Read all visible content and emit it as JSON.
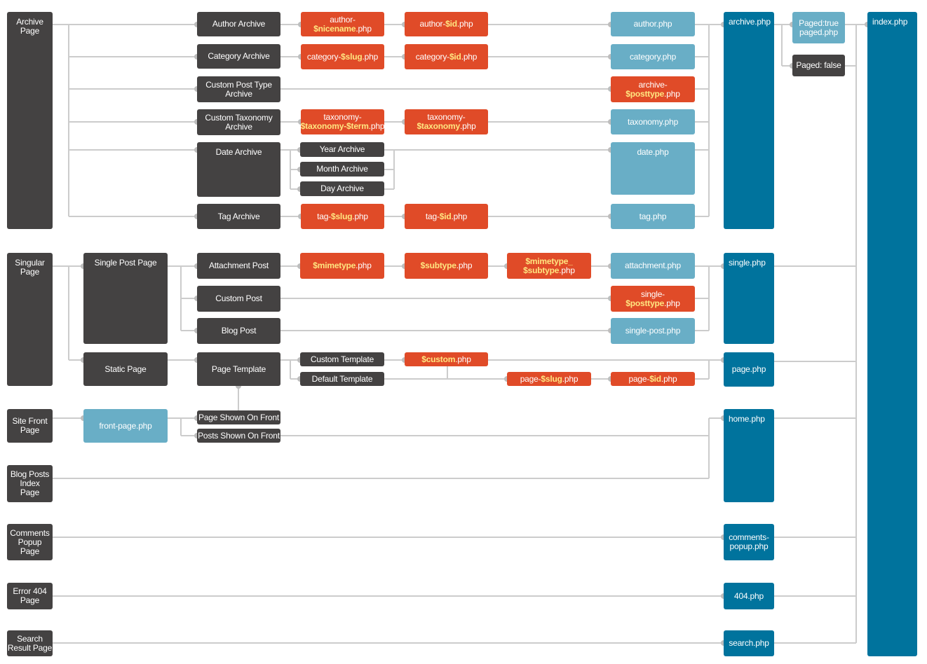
{
  "colors": {
    "dark": "#444242",
    "red": "#e04b28",
    "light": "#69aec6",
    "blue": "#00739d",
    "wire": "#cccccc",
    "variable": "#ffe680"
  },
  "nodes": [
    {
      "id": "archive-page",
      "kind": "dark",
      "lines": [
        [
          {
            "text": "Archive"
          }
        ],
        [
          {
            "text": "Page"
          }
        ]
      ]
    },
    {
      "id": "author-archive",
      "kind": "dark",
      "lines": [
        [
          {
            "text": "Author Archive"
          }
        ]
      ]
    },
    {
      "id": "category-archive",
      "kind": "dark",
      "lines": [
        [
          {
            "text": "Category Archive"
          }
        ]
      ]
    },
    {
      "id": "cpt-archive",
      "kind": "dark",
      "lines": [
        [
          {
            "text": "Custom Post Type"
          }
        ],
        [
          {
            "text": "Archive"
          }
        ]
      ]
    },
    {
      "id": "tax-archive",
      "kind": "dark",
      "lines": [
        [
          {
            "text": "Custom Taxonomy"
          }
        ],
        [
          {
            "text": "Archive"
          }
        ]
      ]
    },
    {
      "id": "date-archive",
      "kind": "dark",
      "lines": [
        [
          {
            "text": "Date Archive"
          }
        ]
      ]
    },
    {
      "id": "tag-archive",
      "kind": "dark",
      "lines": [
        [
          {
            "text": "Tag Archive"
          }
        ]
      ]
    },
    {
      "id": "author-nicename",
      "kind": "red",
      "lines": [
        [
          {
            "text": "author-"
          }
        ],
        [
          {
            "text": "$nicename",
            "var": true
          },
          {
            "text": ".php"
          }
        ]
      ]
    },
    {
      "id": "category-slug",
      "kind": "red",
      "lines": [
        [
          {
            "text": "category-"
          },
          {
            "text": "$slug",
            "var": true
          },
          {
            "text": ".php"
          }
        ]
      ]
    },
    {
      "id": "taxonomy-term",
      "kind": "red",
      "lines": [
        [
          {
            "text": "taxonomy-"
          }
        ],
        [
          {
            "text": "$taxonomy-$term",
            "var": true
          },
          {
            "text": ".php"
          }
        ]
      ]
    },
    {
      "id": "year-archive",
      "kind": "dark",
      "lines": [
        [
          {
            "text": "Year Archive"
          }
        ]
      ]
    },
    {
      "id": "month-archive",
      "kind": "dark",
      "lines": [
        [
          {
            "text": "Month Archive"
          }
        ]
      ]
    },
    {
      "id": "day-archive",
      "kind": "dark",
      "lines": [
        [
          {
            "text": "Day Archive"
          }
        ]
      ]
    },
    {
      "id": "tag-slug",
      "kind": "red",
      "lines": [
        [
          {
            "text": "tag-"
          },
          {
            "text": "$slug",
            "var": true
          },
          {
            "text": ".php"
          }
        ]
      ]
    },
    {
      "id": "author-id",
      "kind": "red",
      "lines": [
        [
          {
            "text": "author-"
          },
          {
            "text": "$id",
            "var": true
          },
          {
            "text": ".php"
          }
        ]
      ]
    },
    {
      "id": "category-id",
      "kind": "red",
      "lines": [
        [
          {
            "text": "category-"
          },
          {
            "text": "$id",
            "var": true
          },
          {
            "text": ".php"
          }
        ]
      ]
    },
    {
      "id": "taxonomy-tax",
      "kind": "red",
      "lines": [
        [
          {
            "text": "taxonomy-"
          }
        ],
        [
          {
            "text": "$taxonomy",
            "var": true
          },
          {
            "text": ".php"
          }
        ]
      ]
    },
    {
      "id": "tag-id",
      "kind": "red",
      "lines": [
        [
          {
            "text": "tag-"
          },
          {
            "text": "$id",
            "var": true
          },
          {
            "text": ".php"
          }
        ]
      ]
    },
    {
      "id": "author-php",
      "kind": "light",
      "lines": [
        [
          {
            "text": "author.php"
          }
        ]
      ]
    },
    {
      "id": "category-php",
      "kind": "light",
      "lines": [
        [
          {
            "text": "category.php"
          }
        ]
      ]
    },
    {
      "id": "archive-posttype",
      "kind": "red",
      "lines": [
        [
          {
            "text": "archive-"
          }
        ],
        [
          {
            "text": "$posttype",
            "var": true
          },
          {
            "text": ".php"
          }
        ]
      ]
    },
    {
      "id": "taxonomy-php",
      "kind": "light",
      "lines": [
        [
          {
            "text": "taxonomy.php"
          }
        ]
      ]
    },
    {
      "id": "date-php",
      "kind": "light",
      "lines": [
        [
          {
            "text": "date.php"
          }
        ]
      ]
    },
    {
      "id": "tag-php",
      "kind": "light",
      "lines": [
        [
          {
            "text": "tag.php"
          }
        ]
      ]
    },
    {
      "id": "archive-php",
      "kind": "blue",
      "lines": [
        [
          {
            "text": "archive.php"
          }
        ]
      ]
    },
    {
      "id": "paged-true",
      "kind": "light",
      "lines": [
        [
          {
            "text": "Paged:true"
          }
        ],
        [
          {
            "text": "paged.php"
          }
        ]
      ]
    },
    {
      "id": "paged-false",
      "kind": "dark",
      "lines": [
        [
          {
            "text": "Paged: false"
          }
        ]
      ]
    },
    {
      "id": "index-php",
      "kind": "blue",
      "lines": [
        [
          {
            "text": "index.php"
          }
        ]
      ]
    },
    {
      "id": "singular-page",
      "kind": "dark",
      "lines": [
        [
          {
            "text": "Singular"
          }
        ],
        [
          {
            "text": "Page"
          }
        ]
      ]
    },
    {
      "id": "single-post-page",
      "kind": "dark",
      "lines": [
        [
          {
            "text": "Single Post Page"
          }
        ]
      ]
    },
    {
      "id": "static-page",
      "kind": "dark",
      "lines": [
        [
          {
            "text": "Static Page"
          }
        ]
      ]
    },
    {
      "id": "attachment-post",
      "kind": "dark",
      "lines": [
        [
          {
            "text": "Attachment Post"
          }
        ]
      ]
    },
    {
      "id": "custom-post",
      "kind": "dark",
      "lines": [
        [
          {
            "text": "Custom Post"
          }
        ]
      ]
    },
    {
      "id": "blog-post",
      "kind": "dark",
      "lines": [
        [
          {
            "text": "Blog Post"
          }
        ]
      ]
    },
    {
      "id": "page-template",
      "kind": "dark",
      "lines": [
        [
          {
            "text": "Page Template"
          }
        ]
      ]
    },
    {
      "id": "mimetype",
      "kind": "red",
      "lines": [
        [
          {
            "text": "$mimetype",
            "var": true
          },
          {
            "text": ".php"
          }
        ]
      ]
    },
    {
      "id": "subtype",
      "kind": "red",
      "lines": [
        [
          {
            "text": "$subtype",
            "var": true
          },
          {
            "text": ".php"
          }
        ]
      ]
    },
    {
      "id": "mimetype-subtype",
      "kind": "red",
      "lines": [
        [
          {
            "text": "$mimetype_",
            "var": true
          }
        ],
        [
          {
            "text": "$subtype",
            "var": true
          },
          {
            "text": ".php"
          }
        ]
      ]
    },
    {
      "id": "attachment-php",
      "kind": "light",
      "lines": [
        [
          {
            "text": "attachment.php"
          }
        ]
      ]
    },
    {
      "id": "single-posttype",
      "kind": "red",
      "lines": [
        [
          {
            "text": "single-"
          }
        ],
        [
          {
            "text": "$posttype",
            "var": true
          },
          {
            "text": ".php"
          }
        ]
      ]
    },
    {
      "id": "single-post-php",
      "kind": "light",
      "lines": [
        [
          {
            "text": "single-post.php"
          }
        ]
      ]
    },
    {
      "id": "single-php",
      "kind": "blue",
      "lines": [
        [
          {
            "text": "single.php"
          }
        ]
      ]
    },
    {
      "id": "custom-template",
      "kind": "dark",
      "lines": [
        [
          {
            "text": "Custom Template"
          }
        ]
      ]
    },
    {
      "id": "default-template",
      "kind": "dark",
      "lines": [
        [
          {
            "text": "Default Template"
          }
        ]
      ]
    },
    {
      "id": "custom-php",
      "kind": "red",
      "lines": [
        [
          {
            "text": "$custom",
            "var": true
          },
          {
            "text": ".php"
          }
        ]
      ]
    },
    {
      "id": "page-slug",
      "kind": "red",
      "lines": [
        [
          {
            "text": "page-"
          },
          {
            "text": "$slug",
            "var": true
          },
          {
            "text": ".php"
          }
        ]
      ]
    },
    {
      "id": "page-id",
      "kind": "red",
      "lines": [
        [
          {
            "text": "page-"
          },
          {
            "text": "$id",
            "var": true
          },
          {
            "text": ".php"
          }
        ]
      ]
    },
    {
      "id": "page-php",
      "kind": "blue",
      "lines": [
        [
          {
            "text": "page.php"
          }
        ]
      ]
    },
    {
      "id": "site-front-page",
      "kind": "dark",
      "lines": [
        [
          {
            "text": "Site Front"
          }
        ],
        [
          {
            "text": "Page"
          }
        ]
      ]
    },
    {
      "id": "front-page-php",
      "kind": "light",
      "lines": [
        [
          {
            "text": "front-page.php"
          }
        ]
      ]
    },
    {
      "id": "page-shown-on-front",
      "kind": "dark",
      "lines": [
        [
          {
            "text": "Page Shown On Front"
          }
        ]
      ]
    },
    {
      "id": "posts-shown-on-front",
      "kind": "dark",
      "lines": [
        [
          {
            "text": "Posts Shown On Front"
          }
        ]
      ]
    },
    {
      "id": "home-php",
      "kind": "blue",
      "lines": [
        [
          {
            "text": "home.php"
          }
        ]
      ]
    },
    {
      "id": "blog-posts-index",
      "kind": "dark",
      "lines": [
        [
          {
            "text": "Blog Posts"
          }
        ],
        [
          {
            "text": "Index"
          }
        ],
        [
          {
            "text": "Page"
          }
        ]
      ]
    },
    {
      "id": "comments-popup-page",
      "kind": "dark",
      "lines": [
        [
          {
            "text": "Comments"
          }
        ],
        [
          {
            "text": "Popup"
          }
        ],
        [
          {
            "text": "Page"
          }
        ]
      ]
    },
    {
      "id": "comments-popup-php",
      "kind": "blue",
      "lines": [
        [
          {
            "text": "comments-"
          }
        ],
        [
          {
            "text": "popup.php"
          }
        ]
      ]
    },
    {
      "id": "error-404-page",
      "kind": "dark",
      "lines": [
        [
          {
            "text": "Error 404"
          }
        ],
        [
          {
            "text": "Page"
          }
        ]
      ]
    },
    {
      "id": "404-php",
      "kind": "blue",
      "lines": [
        [
          {
            "text": "404.php"
          }
        ]
      ]
    },
    {
      "id": "search-result-page",
      "kind": "dark",
      "lines": [
        [
          {
            "text": "Search"
          }
        ],
        [
          {
            "text": "Result Page"
          }
        ]
      ]
    },
    {
      "id": "search-php",
      "kind": "blue",
      "lines": [
        [
          {
            "text": "search.php"
          }
        ]
      ]
    }
  ]
}
